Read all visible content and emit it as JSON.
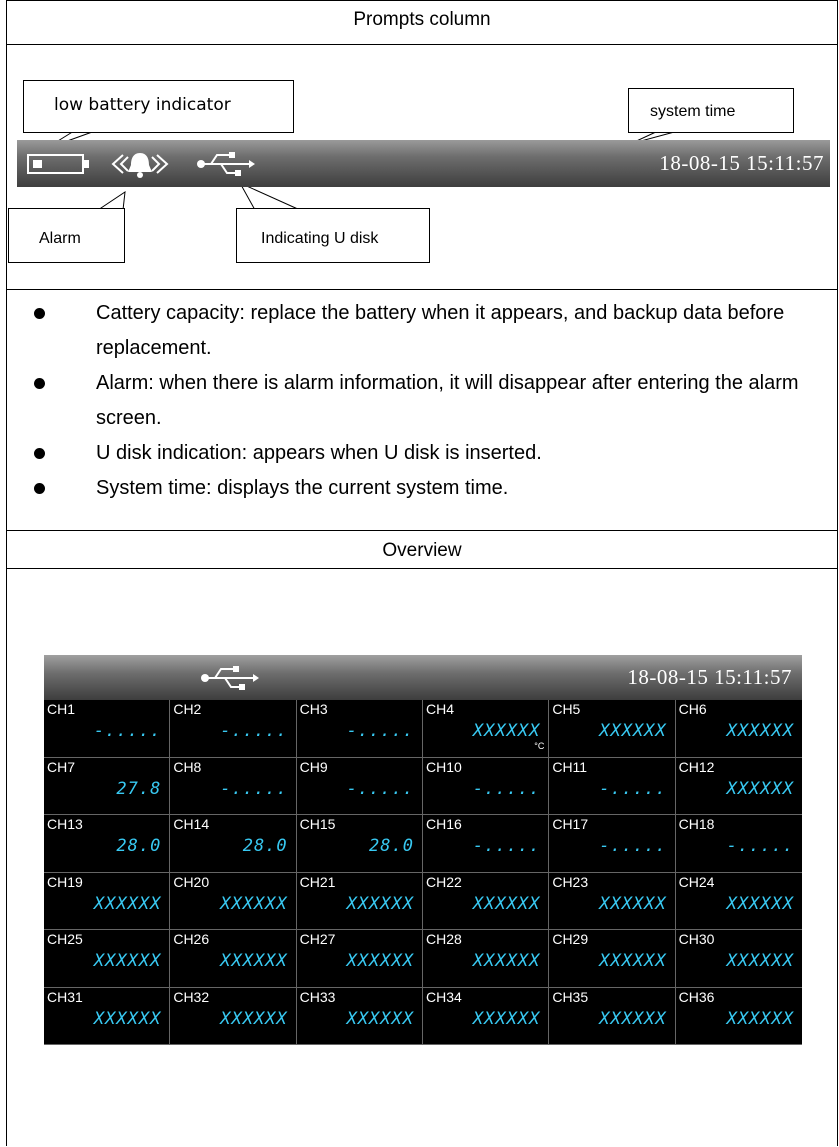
{
  "sections": {
    "prompts_title": "Prompts column",
    "overview_title": "Overview"
  },
  "status_bar": {
    "system_time": "18-08-15  15:11:57",
    "icons": [
      "battery-icon",
      "bell-alarm-icon",
      "usb-icon"
    ]
  },
  "callouts": {
    "low_battery": "low battery indicator",
    "system_time": "system time",
    "alarm": "Alarm",
    "u_disk": "Indicating U disk"
  },
  "bullets": [
    "Cattery capacity: replace the battery when it appears, and backup data before replacement.",
    "Alarm: when there is alarm information, it will disappear after entering the alarm screen.",
    "U disk indication: appears when U disk is inserted.",
    "System time: displays the current system time."
  ],
  "overview": {
    "system_time": "18-08-15  15:11:57",
    "channels": [
      {
        "name": "CH1",
        "value": "-....."
      },
      {
        "name": "CH2",
        "value": "-....."
      },
      {
        "name": "CH3",
        "value": "-....."
      },
      {
        "name": "CH4",
        "value": "XXXXXX",
        "unit": "°C"
      },
      {
        "name": "CH5",
        "value": "XXXXXX"
      },
      {
        "name": "CH6",
        "value": "XXXXXX"
      },
      {
        "name": "CH7",
        "value": "27.8"
      },
      {
        "name": "CH8",
        "value": "-....."
      },
      {
        "name": "CH9",
        "value": "-....."
      },
      {
        "name": "CH10",
        "value": "-....."
      },
      {
        "name": "CH11",
        "value": "-....."
      },
      {
        "name": "CH12",
        "value": "XXXXXX"
      },
      {
        "name": "CH13",
        "value": "28.0"
      },
      {
        "name": "CH14",
        "value": "28.0"
      },
      {
        "name": "CH15",
        "value": "28.0"
      },
      {
        "name": "CH16",
        "value": "-....."
      },
      {
        "name": "CH17",
        "value": "-....."
      },
      {
        "name": "CH18",
        "value": "-....."
      },
      {
        "name": "CH19",
        "value": "XXXXXX"
      },
      {
        "name": "CH20",
        "value": "XXXXXX"
      },
      {
        "name": "CH21",
        "value": "XXXXXX"
      },
      {
        "name": "CH22",
        "value": "XXXXXX"
      },
      {
        "name": "CH23",
        "value": "XXXXXX"
      },
      {
        "name": "CH24",
        "value": "XXXXXX"
      },
      {
        "name": "CH25",
        "value": "XXXXXX"
      },
      {
        "name": "CH26",
        "value": "XXXXXX"
      },
      {
        "name": "CH27",
        "value": "XXXXXX"
      },
      {
        "name": "CH28",
        "value": "XXXXXX"
      },
      {
        "name": "CH29",
        "value": "XXXXXX"
      },
      {
        "name": "CH30",
        "value": "XXXXXX"
      },
      {
        "name": "CH31",
        "value": "XXXXXX"
      },
      {
        "name": "CH32",
        "value": "XXXXXX"
      },
      {
        "name": "CH33",
        "value": "XXXXXX"
      },
      {
        "name": "CH34",
        "value": "XXXXXX"
      },
      {
        "name": "CH35",
        "value": "XXXXXX"
      },
      {
        "name": "CH36",
        "value": "XXXXXX"
      }
    ]
  },
  "colors": {
    "value_text": "#38c9f2",
    "screen_bg": "#000000"
  }
}
